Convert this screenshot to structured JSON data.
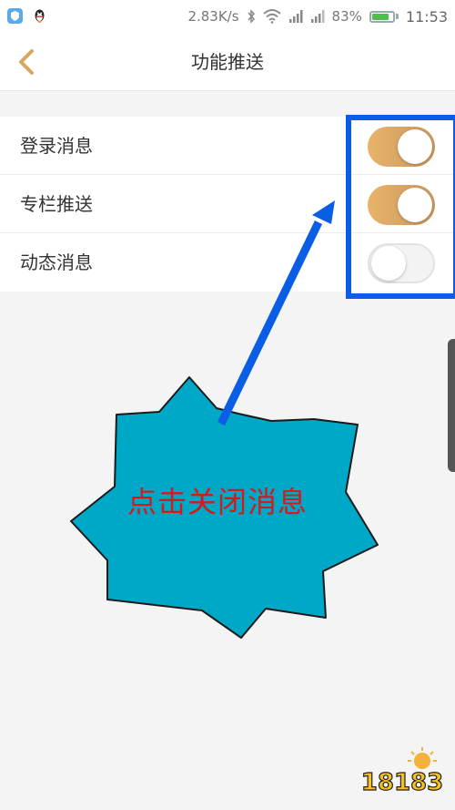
{
  "status_bar": {
    "speed": "2.83K/s",
    "battery_percent": "83%",
    "battery_level": 0.83,
    "time": "11:53",
    "icons": [
      "shield-app-icon",
      "qq-penguin-icon",
      "bluetooth-icon",
      "wifi-icon",
      "signal-icon",
      "signal-icon",
      "battery-icon"
    ]
  },
  "header": {
    "title": "功能推送",
    "back_icon": "chevron-left-icon"
  },
  "settings": [
    {
      "label": "登录消息",
      "enabled": true
    },
    {
      "label": "专栏推送",
      "enabled": true
    },
    {
      "label": "动态消息",
      "enabled": false
    }
  ],
  "annotation": {
    "callout_text": "点击关闭消息",
    "callout_color": "#00a8c8",
    "text_color": "#d21b1b",
    "highlight_color": "#0a5ee6"
  },
  "watermark": {
    "text": "18183"
  },
  "colors": {
    "toggle_on": "#d9a662",
    "accent_back": "#d9a662"
  }
}
